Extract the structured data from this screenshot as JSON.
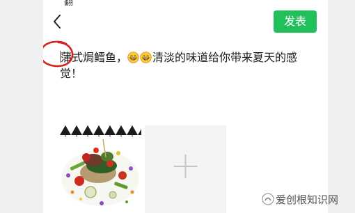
{
  "status_bar": {
    "fragment": "翻"
  },
  "header": {
    "back_icon": "chevron-left",
    "publish_label": "发表",
    "publish_color": "#22c05a"
  },
  "compose": {
    "text_before_emoji": "蒲式焗鳕鱼，",
    "emojis": [
      "grinning-face",
      "grinning-face"
    ],
    "text_after_emoji": "清淡的味道给你带来夏天的感觉！"
  },
  "annotation": {
    "circle_color": "#d6221c"
  },
  "photos": {
    "items": [
      {
        "kind": "image",
        "subject": "plated-fish-dish"
      }
    ],
    "add_icon": "plus"
  },
  "watermark": {
    "text": "爱创根知识网"
  }
}
